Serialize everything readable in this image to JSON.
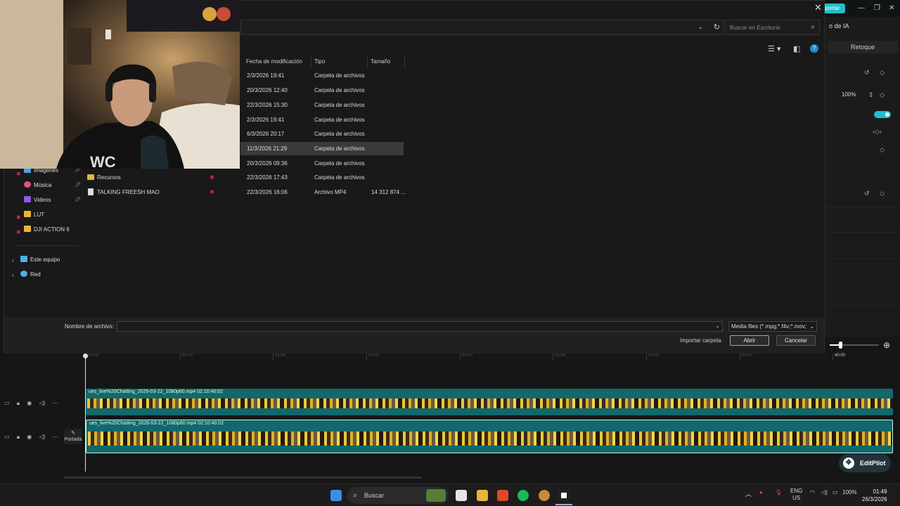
{
  "editor": {
    "export_label": "portar",
    "ia_label": "o de IA",
    "retoque_label": "Retoque",
    "zoom_value": "100%",
    "ruler_ticks": [
      "00:00",
      "00:00",
      "10:00",
      "00:00",
      "00:00",
      "15:00",
      "00:00",
      "00:00",
      "40:00"
    ],
    "portada_label": "Portada",
    "clip1_name": "ues_live%20Chatting_2026-03-22_1080p60.mp4   02:10:40:02",
    "clip2_name": "ues_live%20Chatting_2026-03-22_1080p60.mp4   02:10:40:02",
    "editpilot_label": "EditPilot"
  },
  "dialog": {
    "search_placeholder": "Buscar en Escritorio",
    "columns": [
      "Fecha de modificación",
      "Tipo",
      "Tamaño"
    ],
    "rows": [
      {
        "name": "",
        "date": "2/3/2026 19:41",
        "type": "Carpeta de archivos",
        "size": ""
      },
      {
        "name": "",
        "date": "20/3/2026 12:40",
        "type": "Carpeta de archivos",
        "size": ""
      },
      {
        "name": "",
        "date": "22/3/2026 15:30",
        "type": "Carpeta de archivos",
        "size": ""
      },
      {
        "name": "",
        "date": "2/3/2026 19:41",
        "type": "Carpeta de archivos",
        "size": ""
      },
      {
        "name": "",
        "date": "6/3/2026 20:17",
        "type": "Carpeta de archivos",
        "size": ""
      },
      {
        "name": "",
        "date": "11/3/2026 21:29",
        "type": "Carpeta de archivos",
        "size": ""
      },
      {
        "name": "",
        "date": "20/3/2026 09:36",
        "type": "Carpeta de archivos",
        "size": ""
      },
      {
        "name": "Recursos",
        "date": "22/3/2026 17:43",
        "type": "Carpeta de archivos",
        "size": ""
      },
      {
        "name": "TALKING FREESH MAO",
        "date": "22/3/2026 16:06",
        "type": "Archivo MP4",
        "size": "14 312 874 ..."
      }
    ],
    "nav": [
      {
        "label": "Imágenes"
      },
      {
        "label": "Música"
      },
      {
        "label": "Videos"
      },
      {
        "label": "LUT"
      },
      {
        "label": "DJI ACTION 6"
      },
      {
        "label": "Este equipo"
      },
      {
        "label": "Red"
      }
    ],
    "filename_label": "Nombre de archivo:",
    "filename_value": "",
    "filetype_value": "Media files (*.mpg;*.f4v;*.mov;",
    "import_folder_label": "Importar carpeta",
    "open_label": "Abrir",
    "cancel_label": "Cancelar"
  },
  "taskbar": {
    "search_label": "Buscar",
    "lang_line1": "ENG",
    "lang_line2": "US",
    "battery": "100%",
    "time": "01:49",
    "date": "26/3/2026"
  }
}
